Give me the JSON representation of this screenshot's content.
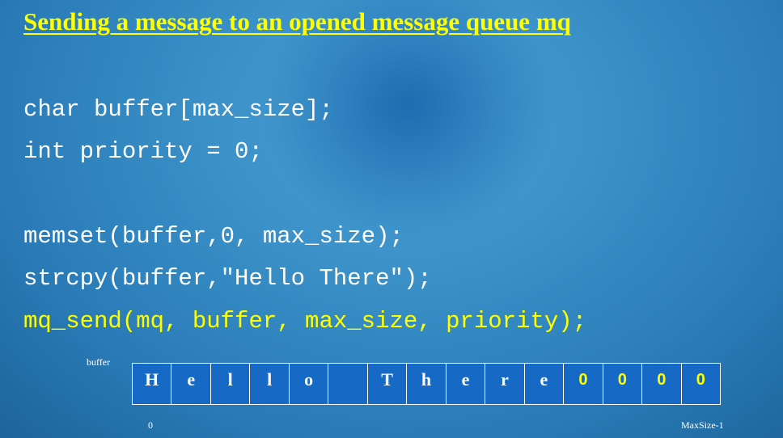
{
  "slide": {
    "title": "Sending a message to an opened message queue mq",
    "code_lines": [
      "char buffer[max_size];",
      "int priority = 0;",
      "memset(buffer,0, max_size);",
      "strcpy(buffer,\"Hello There\");",
      "mq_send(mq, buffer, max_size, priority);"
    ],
    "colors": {
      "title": "#ffff00",
      "code": "#ffffff",
      "highlight": "#ffff00",
      "cell_fill": "#1669c4"
    }
  },
  "buffer_diagram": {
    "label": "buffer",
    "cells": [
      "H",
      "e",
      "l",
      "l",
      "o",
      "",
      "T",
      "h",
      "e",
      "r",
      "e",
      "0",
      "0",
      "0",
      "0"
    ],
    "start_index": "0",
    "end_index": "MaxSize-1"
  }
}
